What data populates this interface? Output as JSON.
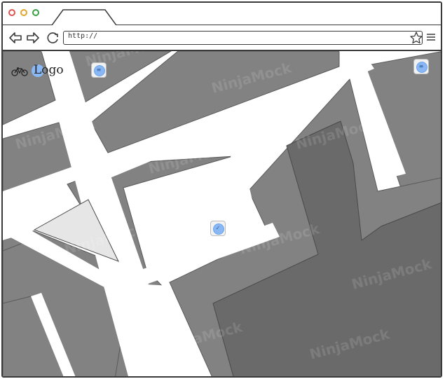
{
  "browser": {
    "url": "http://",
    "icons": {
      "back": "arrow-left-icon",
      "forward": "arrow-right-icon",
      "reload": "reload-icon",
      "bookmark": "star-icon",
      "menu": "hamburger-menu-icon"
    },
    "window_controls": [
      "close",
      "minimize",
      "maximize"
    ]
  },
  "app": {
    "logo_text": "Logo",
    "logo_icon": "bicycle-icon"
  },
  "map": {
    "pins": [
      {
        "name": "map-pin-top-left",
        "icon": "list-icon"
      },
      {
        "name": "map-pin-top-right",
        "icon": "list-icon"
      },
      {
        "name": "map-pin-center",
        "icon": "check-icon"
      }
    ]
  },
  "watermark": "NinjaMock",
  "colors": {
    "road": "#ffffff",
    "block": "#808080",
    "block_dark": "#6a6a6a",
    "park": "#e6e6e6",
    "pin_blue": "#8ab8f4"
  }
}
